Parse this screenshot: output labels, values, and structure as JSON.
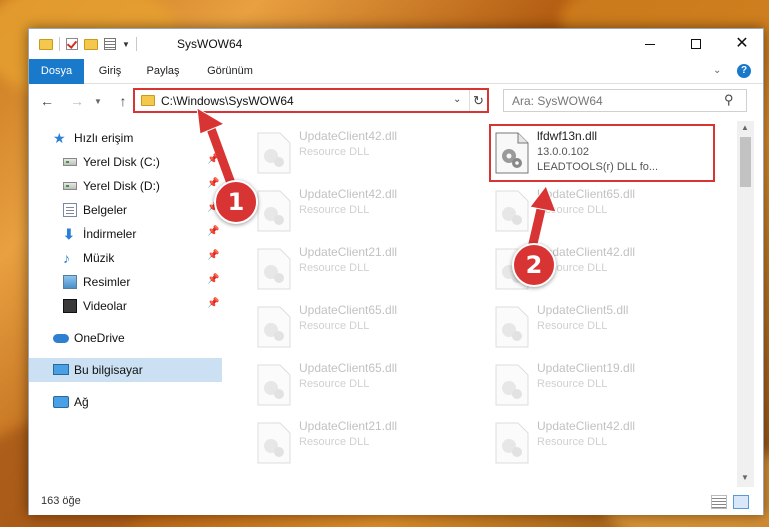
{
  "window": {
    "title": "SysWOW64"
  },
  "ribbon": {
    "tabs": [
      "Dosya",
      "Giriş",
      "Paylaş",
      "Görünüm"
    ],
    "help": "?"
  },
  "nav": {
    "address": "C:\\Windows\\SysWOW64",
    "search_placeholder": "Ara: SysWOW64"
  },
  "sidebar": {
    "items": [
      {
        "label": "Hızlı erişim",
        "icon": "quick-access-star-icon"
      },
      {
        "label": "Yerel Disk (C:)",
        "icon": "drive-icon",
        "pinned": true
      },
      {
        "label": "Yerel Disk (D:)",
        "icon": "drive-icon",
        "pinned": true
      },
      {
        "label": "Belgeler",
        "icon": "documents-icon",
        "pinned": true
      },
      {
        "label": "İndirmeler",
        "icon": "downloads-icon",
        "pinned": true
      },
      {
        "label": "Müzik",
        "icon": "music-icon",
        "pinned": true
      },
      {
        "label": "Resimler",
        "icon": "pictures-icon",
        "pinned": true
      },
      {
        "label": "Videolar",
        "icon": "videos-icon",
        "pinned": true
      },
      {
        "label": "OneDrive",
        "icon": "onedrive-icon"
      },
      {
        "label": "Bu bilgisayar",
        "icon": "this-pc-icon",
        "selected": true
      },
      {
        "label": "Ağ",
        "icon": "network-icon"
      }
    ]
  },
  "files": {
    "highlighted": {
      "name": "lfdwf13n.dll",
      "version": "13.0.0.102",
      "description": "LEADTOOLS(r) DLL fo..."
    },
    "left_column": [
      {
        "name": "UpdateClient42.dll",
        "type": "Resource DLL"
      },
      {
        "name": "UpdateClient42.dll",
        "type": "Resource DLL"
      },
      {
        "name": "UpdateClient21.dll",
        "type": "Resource DLL"
      },
      {
        "name": "UpdateClient65.dll",
        "type": "Resource DLL"
      },
      {
        "name": "UpdateClient65.dll",
        "type": "Resource DLL"
      },
      {
        "name": "UpdateClient21.dll",
        "type": "Resource DLL"
      }
    ],
    "right_column": [
      {
        "name": "UpdateClient65.dll",
        "type": "Resource DLL"
      },
      {
        "name": "UpdateClient42.dll",
        "type": "Resource DLL"
      },
      {
        "name": "UpdateClient5.dll",
        "type": "Resource DLL"
      },
      {
        "name": "UpdateClient19.dll",
        "type": "Resource DLL"
      },
      {
        "name": "UpdateClient42.dll",
        "type": "Resource DLL"
      }
    ]
  },
  "status": {
    "count": "163 öğe"
  },
  "annotations": {
    "step1": "1",
    "step2": "2",
    "color": "#d93434"
  },
  "colors": {
    "accent": "#1979ca",
    "selection": "#cce0f4",
    "highlight": "#d93434"
  }
}
